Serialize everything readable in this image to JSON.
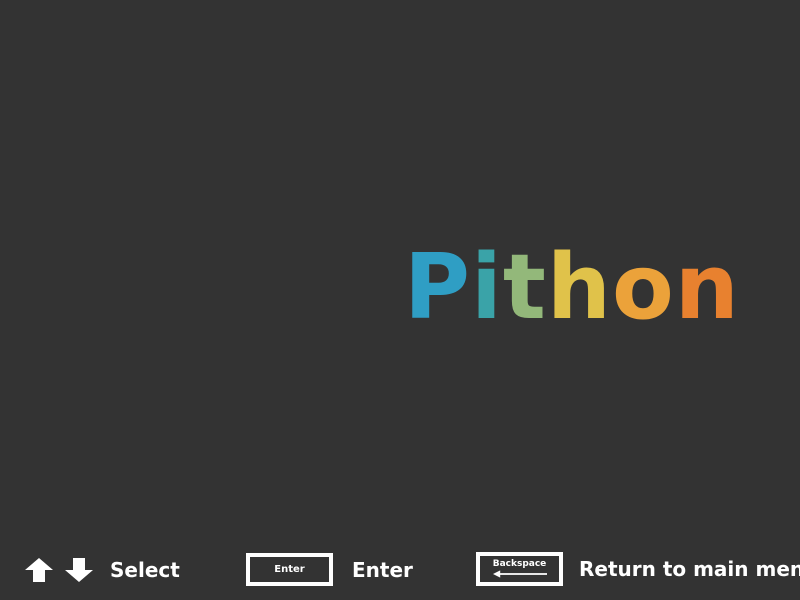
{
  "title": {
    "letters": [
      {
        "char": "P",
        "color": "#2f9ec4"
      },
      {
        "char": "i",
        "color": "#3aa3a8"
      },
      {
        "char": "t",
        "color": "#93b87a"
      },
      {
        "char": "h",
        "color": "#e0c24a"
      },
      {
        "char": "o",
        "color": "#eba23a"
      },
      {
        "char": "n",
        "color": "#e8812f"
      }
    ]
  },
  "footer": {
    "select": {
      "label": "Select",
      "icons": [
        "arrow-up-icon",
        "arrow-down-icon"
      ]
    },
    "enter": {
      "key_label": "Enter",
      "label": "Enter"
    },
    "back": {
      "key_label": "Backspace",
      "label": "Return to main menu",
      "icon": "backspace-arrow-icon"
    }
  }
}
